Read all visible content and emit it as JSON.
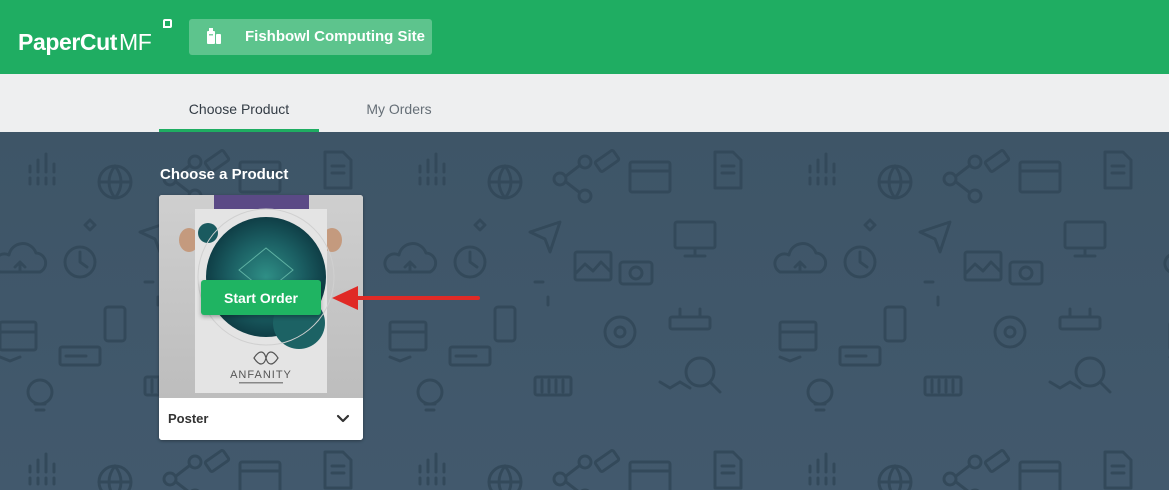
{
  "header": {
    "logo_text": "PaperCut",
    "logo_suffix": "MF",
    "site_button_label": "Fishbowl Computing Site",
    "site_icon": "printer-icon",
    "brand_color": "#1fad62"
  },
  "tabs": [
    {
      "label": "Choose Product",
      "active": true
    },
    {
      "label": "My Orders",
      "active": false
    }
  ],
  "main": {
    "section_title": "Choose a Product",
    "products": [
      {
        "name": "Poster",
        "action_label": "Start Order",
        "expand_icon": "chevron-down-icon"
      }
    ]
  },
  "poster_artwork_text": "ANFANITY",
  "annotation": {
    "type": "red-arrow",
    "color": "#e02a26"
  }
}
